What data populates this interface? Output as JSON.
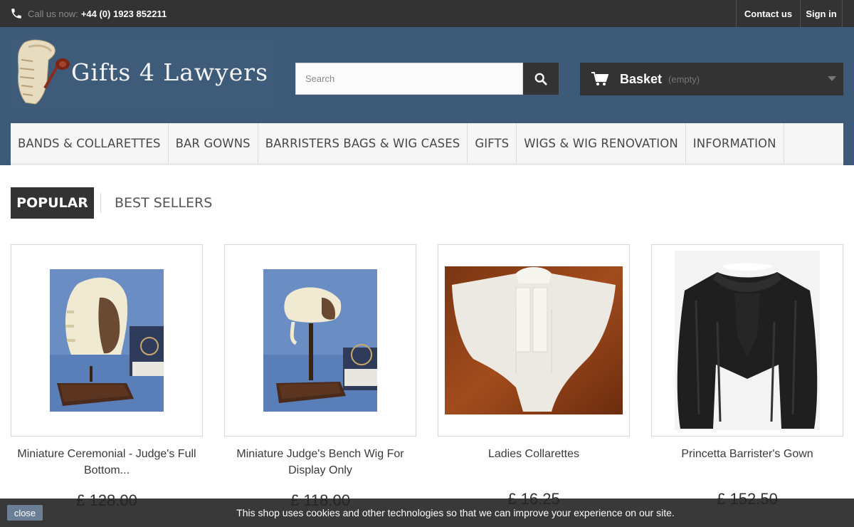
{
  "topbar": {
    "phone_label": "Call us now:",
    "phone_number": "+44 (0) 1923 852211",
    "contact_label": "Contact us",
    "signin_label": "Sign in"
  },
  "header": {
    "logo_text": "Gifts 4 Lawyers",
    "search_placeholder": "Search",
    "basket_label": "Basket",
    "basket_status": "(empty)"
  },
  "menu": {
    "items": [
      "BANDS & COLLARETTES",
      "BAR GOWNS",
      "BARRISTERS BAGS & WIG CASES",
      "GIFTS",
      "WIGS & WIG RENOVATION",
      "INFORMATION"
    ]
  },
  "tabs": {
    "popular": "POPULAR",
    "best_sellers": "BEST SELLERS"
  },
  "products": [
    {
      "name": "Miniature Ceremonial - Judge's Full Bottom...",
      "price": "£ 128.00"
    },
    {
      "name": "Miniature Judge's Bench Wig For Display Only",
      "price": "£ 118.00"
    },
    {
      "name": "Ladies Collarettes",
      "price": "£ 16.25"
    },
    {
      "name": "Princetta Barrister's Gown",
      "price": "£ 152.50"
    }
  ],
  "cookie": {
    "close_label": "close",
    "message": "This shop uses cookies and other technologies so that we can improve your experience on our site."
  },
  "icons": {
    "phone": "phone-icon",
    "search": "search-icon",
    "cart": "cart-icon",
    "dropdown": "chevron-down-icon"
  },
  "colors": {
    "header_bg": "#3d5a78",
    "dark": "#333333",
    "menu_bg": "#f6f6f6"
  }
}
